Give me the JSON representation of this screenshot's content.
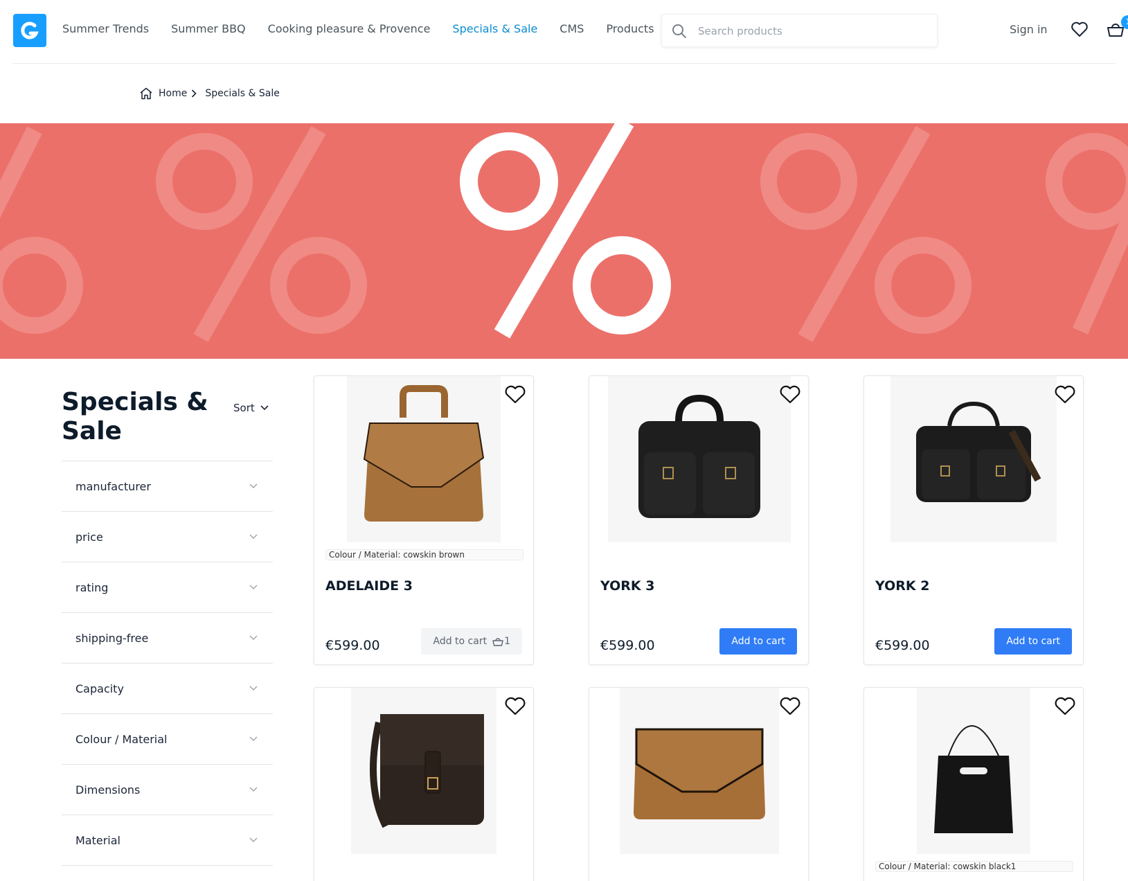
{
  "header": {
    "nav": [
      "Summer Trends",
      "Summer BBQ",
      "Cooking pleasure & Provence",
      "Specials & Sale",
      "CMS",
      "Products"
    ],
    "active_nav": "Specials & Sale",
    "search_placeholder": "Search products",
    "sign_in": "Sign in",
    "cart_count": "1"
  },
  "breadcrumb": {
    "home": "Home",
    "current": "Specials & Sale"
  },
  "category": {
    "title": "Specials & Sale",
    "sort_label": "Sort",
    "filters": [
      "manufacturer",
      "price",
      "rating",
      "shipping-free",
      "Capacity",
      "Colour / Material",
      "Dimensions",
      "Material"
    ]
  },
  "products": [
    {
      "name": "ADELAIDE 3",
      "price": "€599.00",
      "variant": "Colour / Material: cowskin brown",
      "button": "Add to cart",
      "cart_qty": "1",
      "in_cart": true
    },
    {
      "name": "YORK 3",
      "price": "€599.00",
      "variant": "",
      "button": "Add to cart",
      "in_cart": false
    },
    {
      "name": "YORK 2",
      "price": "€599.00",
      "variant": "",
      "button": "Add to cart",
      "in_cart": false
    },
    {
      "name": "",
      "price": "",
      "variant": "",
      "button": ""
    },
    {
      "name": "",
      "price": "",
      "variant": "",
      "button": ""
    },
    {
      "name": "",
      "price": "",
      "variant": "Colour / Material: cowskin black1",
      "button": ""
    }
  ],
  "colors": {
    "accent": "#189eff",
    "banner": "#ec706a",
    "primary_button": "#2f7cf6"
  }
}
